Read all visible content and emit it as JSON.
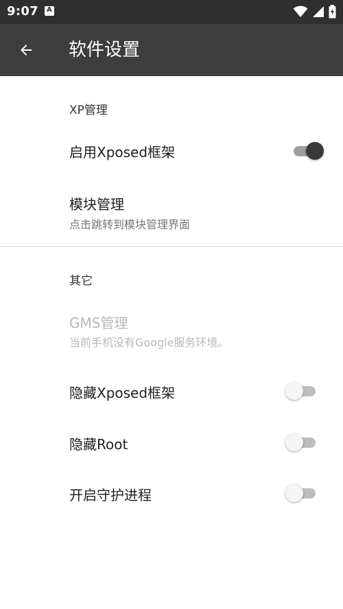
{
  "status_bar": {
    "time": "9:07",
    "notification_icon": "a-notification-icon",
    "icons": [
      "wifi-icon",
      "signal-icon",
      "battery-icon"
    ]
  },
  "app_bar": {
    "back_icon": "arrow-back-icon",
    "title": "软件设置"
  },
  "sections": {
    "xp": {
      "header": "XP管理",
      "enable_xposed": {
        "title": "启用Xposed框架",
        "checked": true
      },
      "module_manage": {
        "title": "模块管理",
        "subtitle": "点击跳转到模块管理界面"
      }
    },
    "other": {
      "header": "其它",
      "gms": {
        "title": "GMS管理",
        "subtitle": "当前手机没有Google服务环境。",
        "enabled": false
      },
      "hide_xposed": {
        "title": "隐藏Xposed框架",
        "checked": false
      },
      "hide_root": {
        "title": "隐藏Root",
        "checked": false
      },
      "guard_process": {
        "title": "开启守护进程",
        "checked": false
      }
    }
  },
  "colors": {
    "status_bar": "#2f2f2f",
    "app_bar": "#3d3d3d",
    "switch_on_thumb": "#3a3a3a"
  }
}
